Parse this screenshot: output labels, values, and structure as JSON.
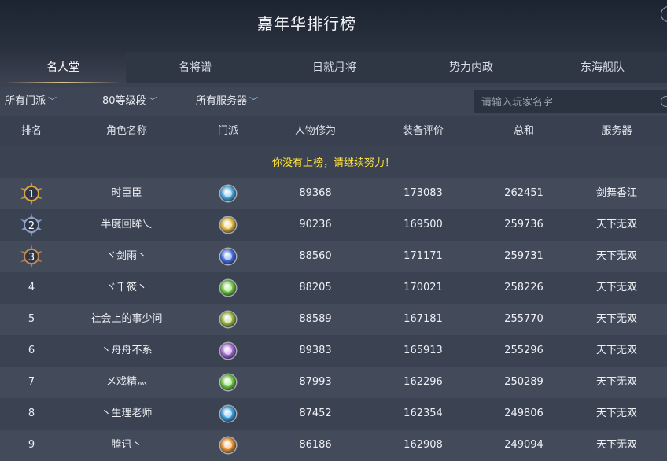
{
  "header": {
    "title": "嘉年华排行榜"
  },
  "tabs": [
    {
      "label": "名人堂",
      "active": true
    },
    {
      "label": "名将谱",
      "active": false
    },
    {
      "label": "日就月将",
      "active": false
    },
    {
      "label": "势力内政",
      "active": false
    },
    {
      "label": "东海舰队",
      "active": false
    }
  ],
  "filters": {
    "sect": "所有门派",
    "level": "80等级段",
    "server": "所有服务器"
  },
  "search": {
    "placeholder": "请输入玩家名字"
  },
  "columns": {
    "rank": "排名",
    "name": "角色名称",
    "sect": "门派",
    "cultivation": "人物修为",
    "equipment": "装备评价",
    "total": "总和",
    "server": "服务器"
  },
  "notice": "你没有上榜，请继续努力！",
  "rows": [
    {
      "rank": "1",
      "name": "时臣臣",
      "cultivation": "89368",
      "equipment": "173083",
      "total": "262451",
      "server": "剑舞香江",
      "sect_color": "#4aa8e0"
    },
    {
      "rank": "2",
      "name": "半度回眸乀",
      "cultivation": "90236",
      "equipment": "169500",
      "total": "259736",
      "server": "天下无双",
      "sect_color": "#e0b83a"
    },
    {
      "rank": "3",
      "name": "ヾ剑雨丶",
      "cultivation": "88560",
      "equipment": "171171",
      "total": "259731",
      "server": "天下无双",
      "sect_color": "#3f6fe0"
    },
    {
      "rank": "4",
      "name": "ヾ千筱丶",
      "cultivation": "88205",
      "equipment": "170021",
      "total": "258226",
      "server": "天下无双",
      "sect_color": "#6ec83e"
    },
    {
      "rank": "5",
      "name": "社会上的事少问",
      "cultivation": "88589",
      "equipment": "167181",
      "total": "255770",
      "server": "天下无双",
      "sect_color": "#9ab63c"
    },
    {
      "rank": "6",
      "name": "丶舟舟不系",
      "cultivation": "89383",
      "equipment": "165913",
      "total": "255296",
      "server": "天下无双",
      "sect_color": "#a569d8"
    },
    {
      "rank": "7",
      "name": "メ戏精灬",
      "cultivation": "87993",
      "equipment": "162296",
      "total": "250289",
      "server": "天下无双",
      "sect_color": "#6ec83e"
    },
    {
      "rank": "8",
      "name": "丶生理老师",
      "cultivation": "87452",
      "equipment": "162354",
      "total": "249806",
      "server": "天下无双",
      "sect_color": "#3aa0e0"
    },
    {
      "rank": "9",
      "name": "腾讯丶",
      "cultivation": "86186",
      "equipment": "162908",
      "total": "249094",
      "server": "天下无双",
      "sect_color": "#e8922e"
    }
  ],
  "medal_colors": {
    "gold": "#d9a441",
    "silver": "#8ea2c8",
    "bronze": "#b98a5c"
  }
}
